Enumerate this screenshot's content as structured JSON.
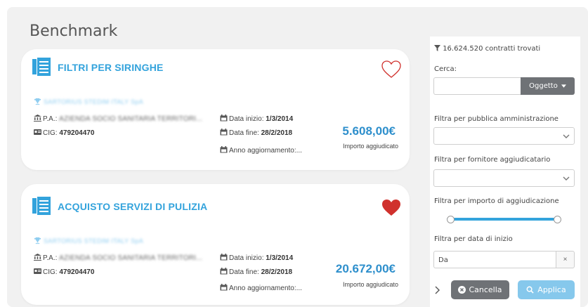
{
  "page": {
    "title": "Benchmark"
  },
  "cards": [
    {
      "title": "FILTRI PER SIRINGHE",
      "favorite": false,
      "supplier": "SARTORIUS STEDIM ITALY SpA",
      "pa_label": "P.A.:",
      "pa_value": "AZIENDA SOCIO SANITARIA TERRITORI...",
      "cig_label": "CIG:",
      "cig_value": "479204470",
      "start_label": "Data inizio:",
      "start_value": "1/3/2014",
      "end_label": "Data fine:",
      "end_value": "28/2/2018",
      "update_label": "Anno aggiornamento:...",
      "amount": "5.608,00€",
      "amount_label": "Importo aggiudicato"
    },
    {
      "title": "ACQUISTO SERVIZI DI PULIZIA",
      "favorite": true,
      "supplier": "SARTORIUS STEDIM ITALY SpA",
      "pa_label": "P.A.:",
      "pa_value": "AZIENDA SOCIO SANITARIA TERRITORI...",
      "cig_label": "CIG:",
      "cig_value": "479204470",
      "start_label": "Data inizio:",
      "start_value": "1/3/2014",
      "end_label": "Data fine:",
      "end_value": "28/2/2018",
      "update_label": "Anno aggiornamento:...",
      "amount": "20.672,00€",
      "amount_label": "Importo aggiudicato"
    }
  ],
  "filters": {
    "found": "16.624.520 contratti trovati",
    "search_label": "Cerca:",
    "search_value": "",
    "search_scope": "Oggetto",
    "pa_label": "Filtra per pubblica amministrazione",
    "supplier_label": "Filtra per fornitore aggiudicatario",
    "amount_label": "Filtra per importo di aggiudicazione",
    "amount_range": [
      0,
      1
    ],
    "date_label": "Filtra per data di inizio",
    "date_value": "Da",
    "date_clear": "×",
    "cancel_label": "Cancella",
    "apply_label": "Applica"
  },
  "colors": {
    "accent": "#33a3dc",
    "heart": "#d0312d",
    "button_gray": "#6f7276",
    "apply": "#86c8ec"
  },
  "icons": [
    "documents-icon",
    "heart-outline-icon",
    "heart-filled-icon",
    "trophy-icon",
    "bank-icon",
    "id-card-icon",
    "calendar-icon",
    "filter-icon",
    "chevron-down-icon",
    "times-circle-icon",
    "search-icon",
    "chevron-right-icon"
  ]
}
